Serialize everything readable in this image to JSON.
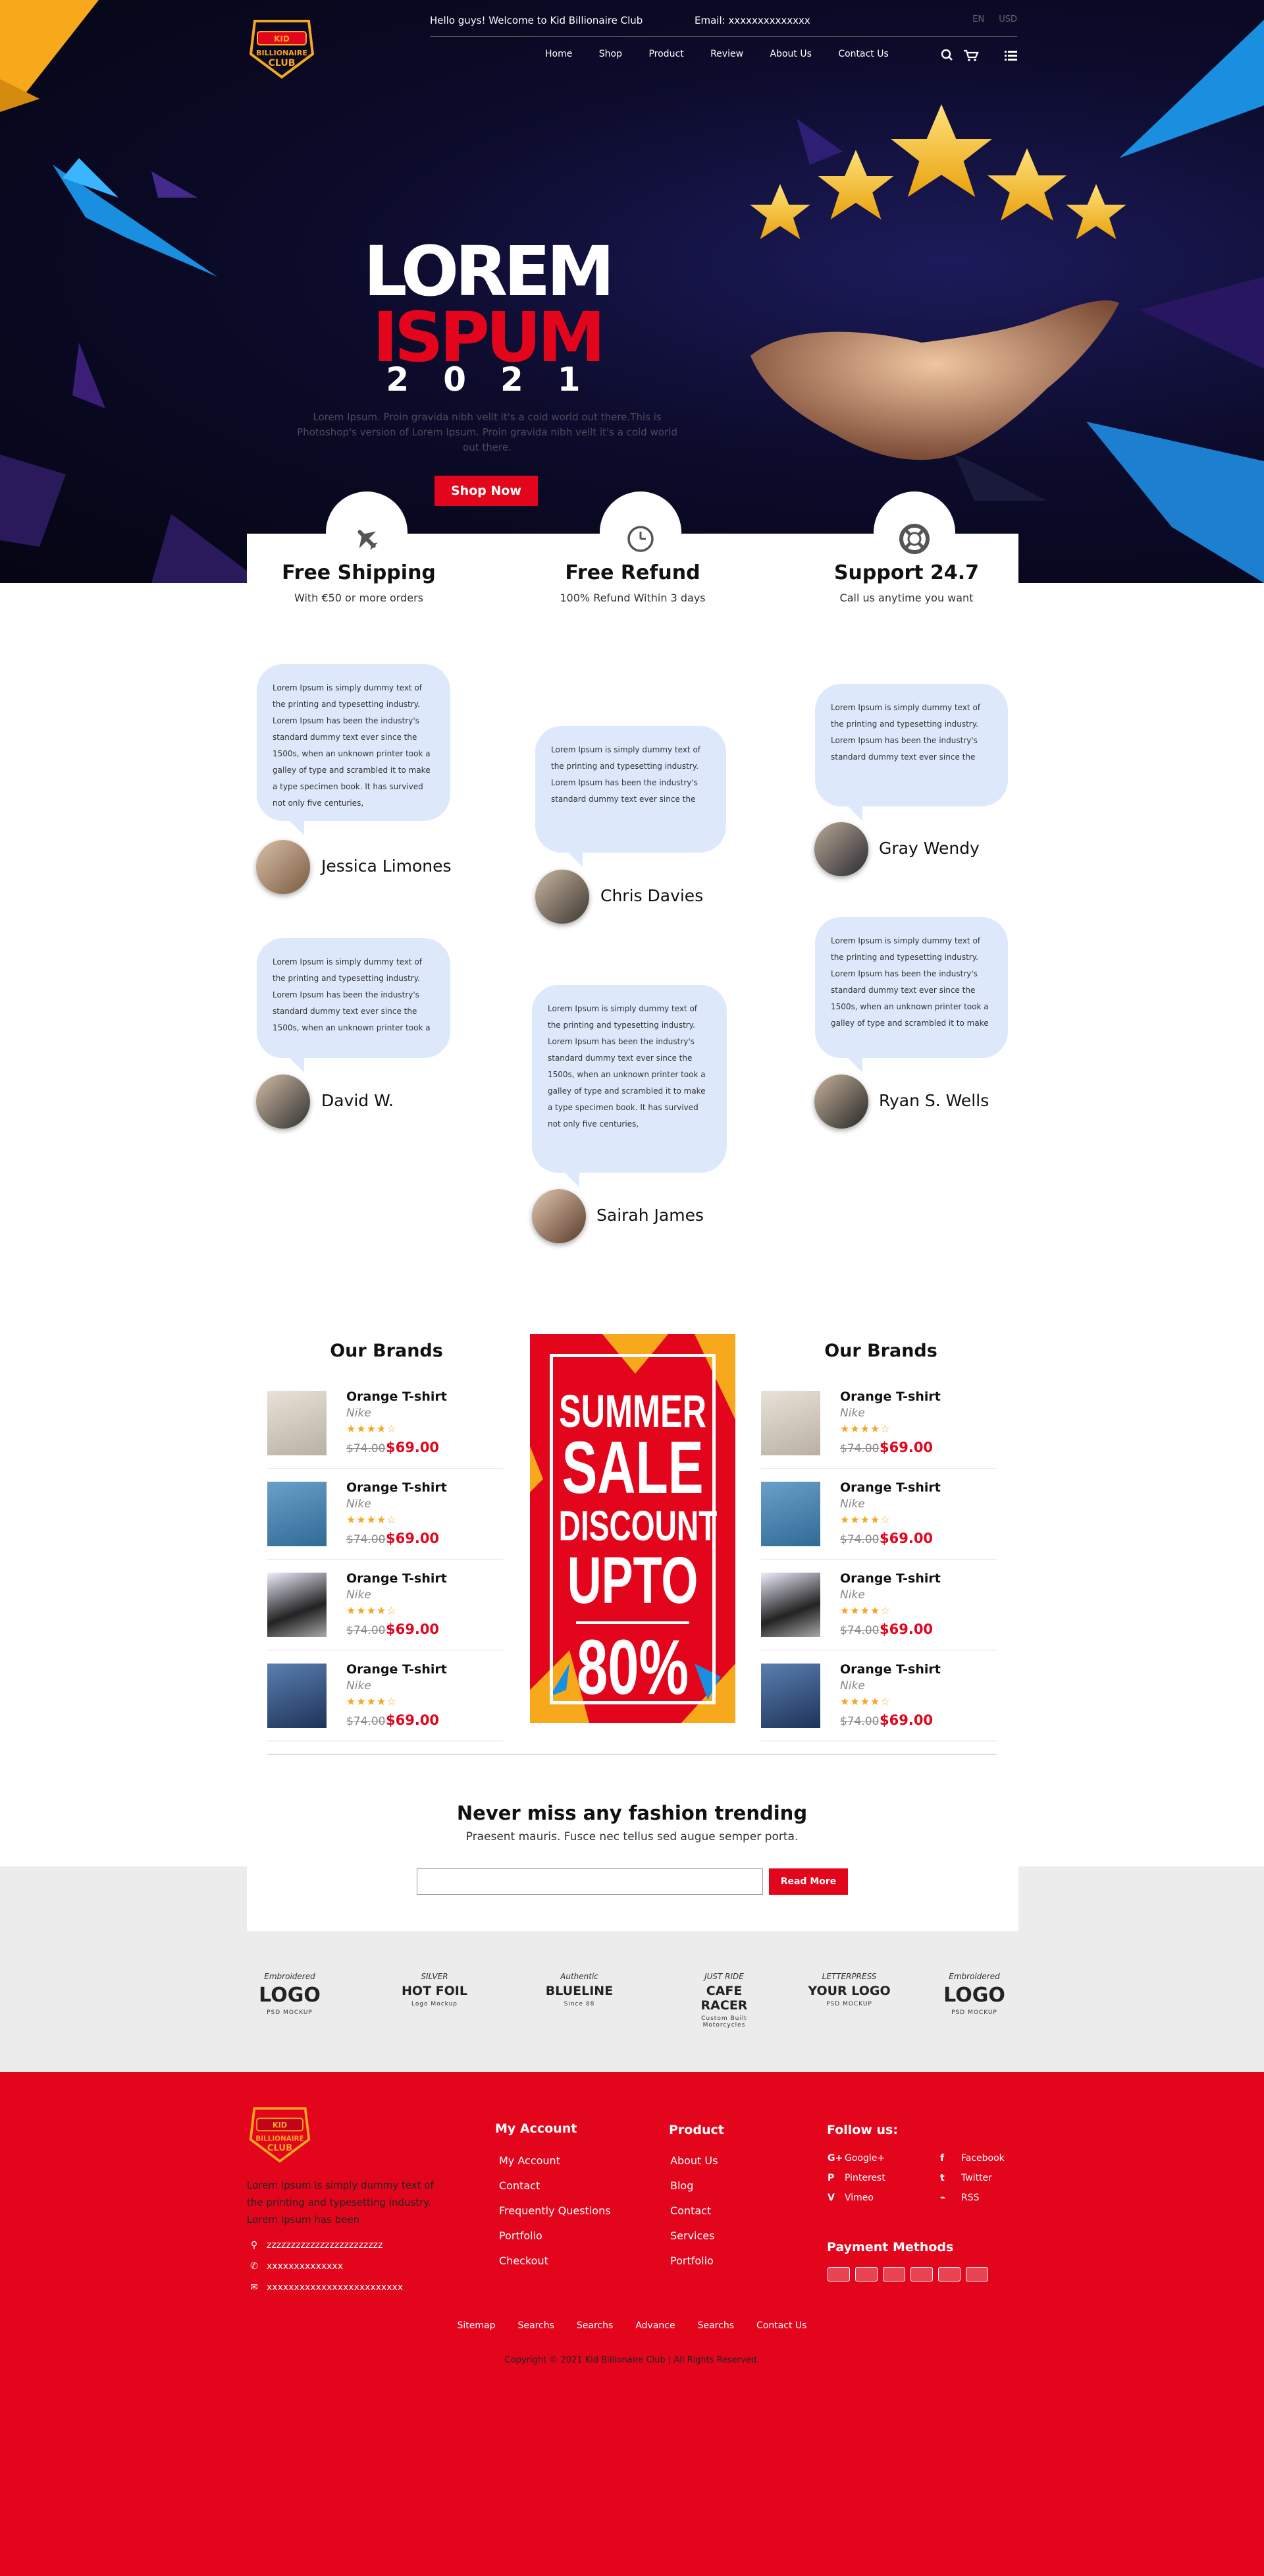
{
  "header": {
    "welcome": "Hello guys! Welcome to Kid Billionaire Club",
    "email": "Email: xxxxxxxxxxxxxx",
    "lang_en": "EN",
    "lang_usd": "USD",
    "logo_text": "KID BILLIONAIRE CLUB",
    "nav": [
      "Home",
      "Shop",
      "Product",
      "Review",
      "About Us",
      "Contact Us"
    ]
  },
  "hero": {
    "line1": "LOREM",
    "line2": "ISPUM",
    "line3": "2021",
    "text": "Lorem Ipsum. Proin gravida nibh vellt it's a cold world out there.This is Photoshop's version of Lorem Ipsum. Proin gravida nibh vellt it's a cold world out there.",
    "button": "Shop Now"
  },
  "features": [
    {
      "title": "Free Shipping",
      "sub": "With €50 or more orders",
      "icon": "airplane-icon"
    },
    {
      "title": "Free Refund",
      "sub": "100% Refund Within 3 days",
      "icon": "clock-icon"
    },
    {
      "title": "Support 24.7",
      "sub": "Call us anytime you want",
      "icon": "lifebuoy-icon"
    }
  ],
  "testimonials": [
    {
      "name": "Jessica Limones",
      "text": "Lorem Ipsum is simply dummy text of the printing and typesetting industry. Lorem Ipsum has been the industry's standard dummy text ever since the 1500s, when an unknown printer took a galley of type and scrambled it to make a type specimen book. It has survived not only five centuries,"
    },
    {
      "name": "Chris Davies",
      "text": "Lorem Ipsum is simply dummy text of the printing and typesetting industry. Lorem Ipsum has been the industry's standard dummy text ever since the"
    },
    {
      "name": "Gray Wendy",
      "text": "Lorem Ipsum is simply dummy text of the printing and typesetting industry. Lorem Ipsum has been the industry's standard dummy text ever since the"
    },
    {
      "name": "David W.",
      "text": "Lorem Ipsum is simply dummy text of the printing and typesetting industry. Lorem Ipsum has been the industry's standard dummy text ever since the 1500s, when an unknown printer took a"
    },
    {
      "name": "Sairah James",
      "text": "Lorem Ipsum is simply dummy text of the printing and typesetting industry. Lorem Ipsum has been the industry's standard dummy text ever since the 1500s, when an unknown printer took a galley of type and scrambled it to make a type specimen book. It has survived not only five centuries,"
    },
    {
      "name": "Ryan S. Wells",
      "text": "Lorem Ipsum is simply dummy text of the printing and typesetting industry. Lorem Ipsum has been the industry's standard dummy text ever since the 1500s, when an unknown printer took a galley of type and scrambled it to make"
    }
  ],
  "brands": {
    "title_left": "Our Brands",
    "title_right": "Our Brands",
    "products": [
      {
        "title": "Orange T-shirt",
        "brand": "Nike",
        "stars": "★★★★☆",
        "old": "$74.00",
        "new": "$69.00"
      },
      {
        "title": "Orange T-shirt",
        "brand": "Nike",
        "stars": "★★★★☆",
        "old": "$74.00",
        "new": "$69.00"
      },
      {
        "title": "Orange T-shirt",
        "brand": "Nike",
        "stars": "★★★★☆",
        "old": "$74.00",
        "new": "$69.00"
      },
      {
        "title": "Orange T-shirt",
        "brand": "Nike",
        "stars": "★★★★☆",
        "old": "$74.00",
        "new": "$69.00"
      }
    ]
  },
  "banner": {
    "l1": "SUMMER",
    "l2": "SALE",
    "l3": "DISCOUNT",
    "l4": "UPTO",
    "l5": "80%"
  },
  "newsletter": {
    "title": "Never miss any fashion trending",
    "sub": "Praesent mauris. Fusce nec tellus sed augue semper porta.",
    "button": "Read More"
  },
  "partner_logos": [
    {
      "top": "Embroidered",
      "main": "LOGO",
      "bottom": "PSD MOCKUP"
    },
    {
      "top": "SILVER",
      "main": "HOT FOIL",
      "bottom": "Logo Mockup"
    },
    {
      "top": "Authentic",
      "main": "BLUELINE",
      "bottom": "Since 88"
    },
    {
      "top": "JUST RIDE",
      "main": "CAFE RACER",
      "bottom": "Custom Built Motorcycles"
    },
    {
      "top": "LETTERPRESS",
      "main": "YOUR LOGO",
      "bottom": "PSD MOCKUP"
    },
    {
      "top": "Embroidered",
      "main": "LOGO",
      "bottom": "PSD MOCKUP"
    }
  ],
  "footer": {
    "about": "Lorem Ipsum is simply dummy text of the printing and typesetting industry. Lorem Ipsum has been",
    "address": "zzzzzzzzzzzzzzzzzzzzzzzz",
    "phone": "xxxxxxxxxxxxxx",
    "email": "xxxxxxxxxxxxxxxxxxxxxxxxx",
    "account_title": "My Account",
    "account_links": [
      "My Account",
      "Contact",
      "Frequently Questions",
      "Portfolio",
      "Checkout"
    ],
    "product_title": "Product",
    "product_links": [
      "About Us",
      "Blog",
      "Contact",
      "Services",
      "Portfolio"
    ],
    "follow_title": "Follow us:",
    "social_left": [
      "Google+",
      "Pinterest",
      "Vimeo"
    ],
    "social_right": [
      "Facebook",
      "Twitter",
      "RSS"
    ],
    "payment_title": "Payment Methods",
    "bottom_links": [
      "Sitemap",
      "Searchs",
      "Searchs",
      "Advance",
      "Searchs",
      "Contact Us"
    ],
    "copyright": "Copyright © 2021 Kid Billionaire Club  |   All Rights Reserved."
  },
  "colors": {
    "accent": "#e3051b",
    "bubble": "#dde9fb",
    "hero_bg": "#0c0b2b",
    "star": "#f5a623"
  }
}
